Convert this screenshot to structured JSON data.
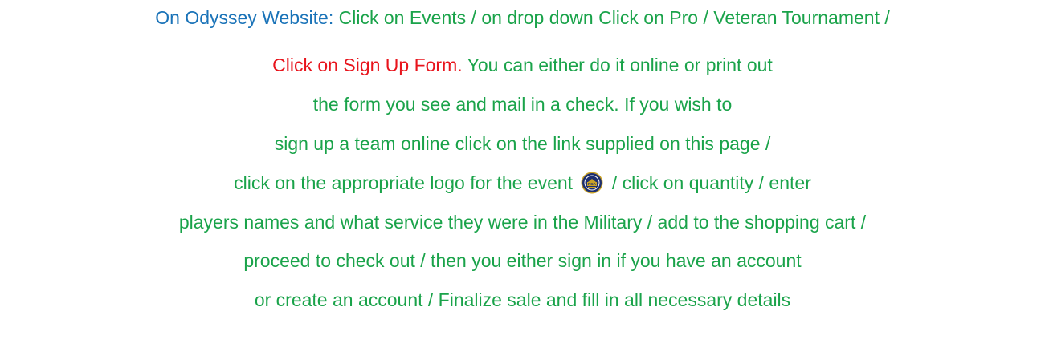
{
  "document": {
    "line1": {
      "blue": "On Odyssey Website:",
      "green": " Click on Events / on drop down Click on Pro / Veteran Tournament /"
    },
    "line2": {
      "red": "Click on Sign Up Form.",
      "green": " You can either do it online or print out"
    },
    "line3": "the form you see and mail in a check. If you wish to",
    "line4": "sign up a team online click on the link supplied on this page /",
    "line5": {
      "before": "click on the appropriate logo for the event ",
      "logo_icon": "pga-logo-icon",
      "after": " / click on quantity / enter"
    },
    "line6": "players names and what service they were in the Military / add to the shopping cart /",
    "line7": "proceed to check out /  then you either sign in if you have an account",
    "line8": "or create an account / Finalize sale and fill in all necessary details"
  },
  "colors": {
    "blue": "#1a73b8",
    "red": "#e8141c",
    "green": "#1aa34a"
  }
}
